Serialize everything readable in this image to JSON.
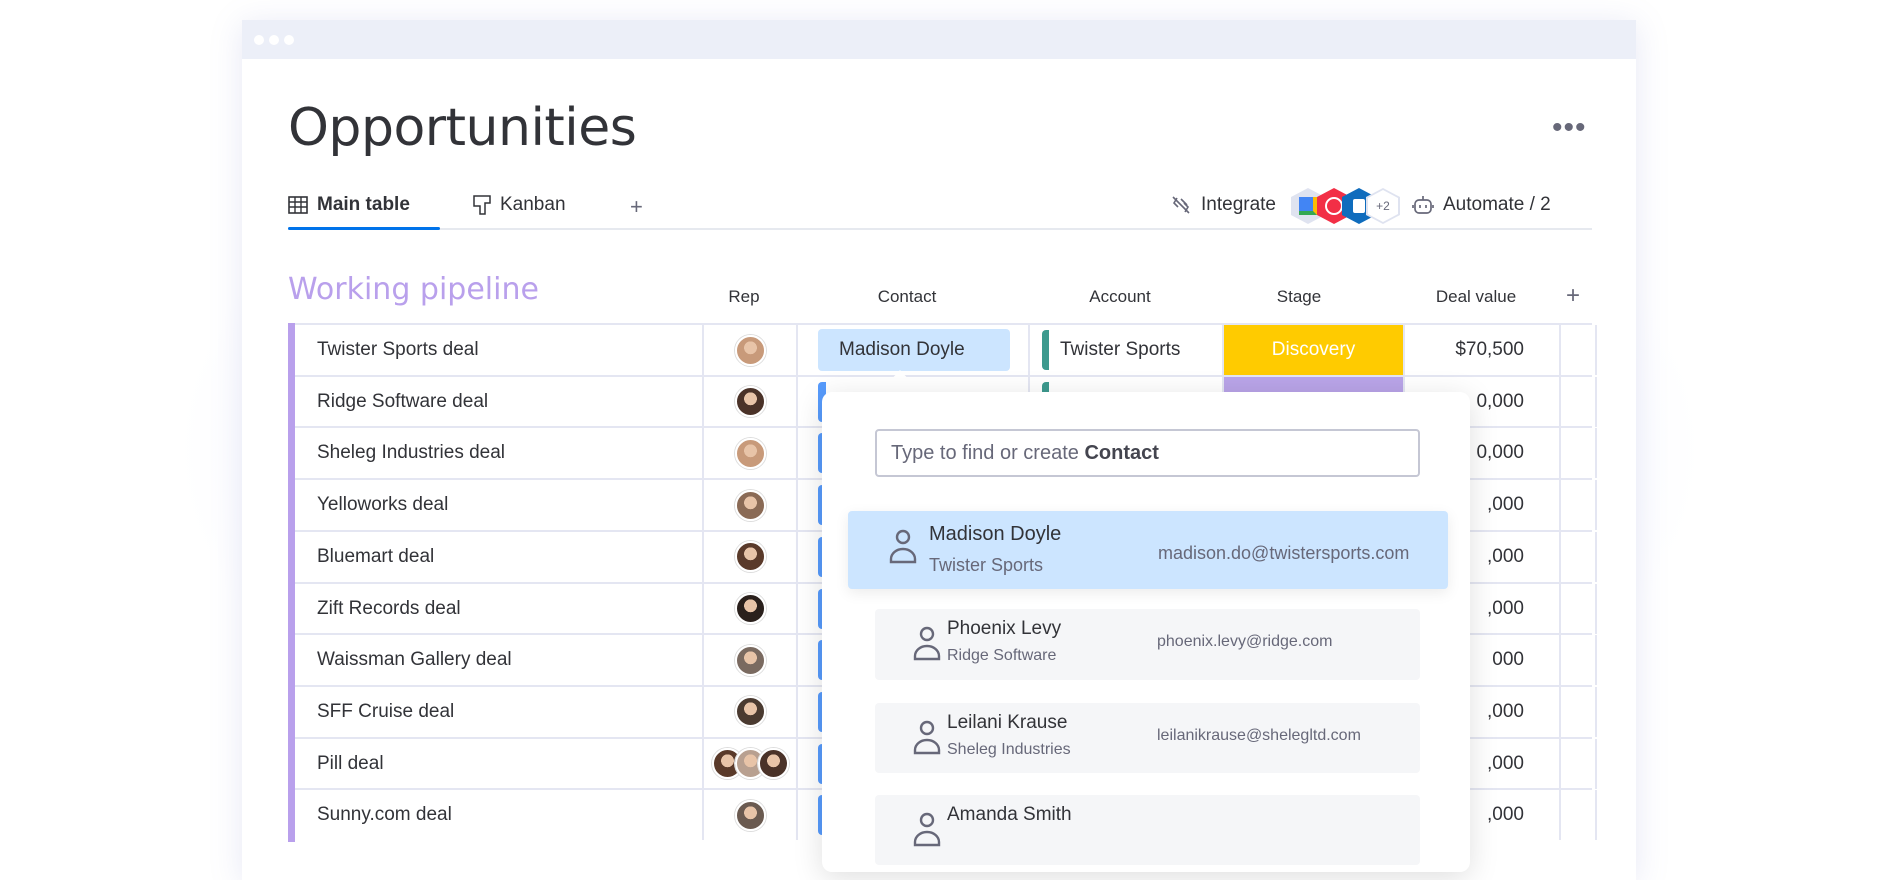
{
  "window": {
    "title": "Opportunities"
  },
  "tabs": [
    {
      "label": "Main table",
      "icon": "table-icon",
      "active": true
    },
    {
      "label": "Kanban",
      "icon": "kanban-icon",
      "active": false
    }
  ],
  "add_tab_label": "+",
  "toolbar": {
    "integrate_label": "Integrate",
    "integration_more": "+2",
    "integration_icons": [
      "google-calendar-icon",
      "twilio-icon",
      "outlook-icon"
    ],
    "automate_label": "Automate / 2"
  },
  "group": {
    "title": "Working pipeline",
    "color": "#b9a0ec",
    "columns": {
      "rep": "Rep",
      "contact": "Contact",
      "account": "Account",
      "stage": "Stage",
      "deal_value": "Deal value",
      "add": "+"
    }
  },
  "rows": [
    {
      "name": "Twister Sports deal",
      "reps": [
        "#c89a7a"
      ],
      "contact": "Madison Doyle",
      "account": "Twister Sports",
      "stage": "Discovery",
      "stage_color": "#ffcb00",
      "deal_value": "$70,500"
    },
    {
      "name": "Ridge Software deal",
      "reps": [
        "#4a3228"
      ],
      "contact": "",
      "account": "",
      "stage": "",
      "stage_color": "#b9a4e8",
      "deal_value": "0,000"
    },
    {
      "name": "Sheleg Industries deal",
      "reps": [
        "#c89a7a"
      ],
      "contact": "",
      "account": "",
      "stage": "",
      "stage_color": "",
      "deal_value": "0,000"
    },
    {
      "name": "Yelloworks deal",
      "reps": [
        "#8a6a55"
      ],
      "contact": "",
      "account": "",
      "stage": "",
      "stage_color": "",
      "deal_value": ",000"
    },
    {
      "name": "Bluemart deal",
      "reps": [
        "#5a3a2a"
      ],
      "contact": "",
      "account": "",
      "stage": "",
      "stage_color": "",
      "deal_value": ",000"
    },
    {
      "name": "Zift Records deal",
      "reps": [
        "#2a201c"
      ],
      "contact": "",
      "account": "",
      "stage": "",
      "stage_color": "",
      "deal_value": ",000"
    },
    {
      "name": "Waissman Gallery deal",
      "reps": [
        "#7a6a60"
      ],
      "contact": "",
      "account": "",
      "stage": "",
      "stage_color": "",
      "deal_value": "000"
    },
    {
      "name": "SFF Cruise deal",
      "reps": [
        "#4a3a30"
      ],
      "contact": "",
      "account": "",
      "stage": "",
      "stage_color": "",
      "deal_value": ",000"
    },
    {
      "name": "Pill deal",
      "reps": [
        "#5a3a2a",
        "#b8a090",
        "#4a3228"
      ],
      "contact": "",
      "account": "",
      "stage": "",
      "stage_color": "",
      "deal_value": ",000"
    },
    {
      "name": "Sunny.com deal",
      "reps": [
        "#6a5a50"
      ],
      "contact": "",
      "account": "",
      "stage": "",
      "stage_color": "",
      "deal_value": ",000"
    }
  ],
  "contact_picker": {
    "placeholder_prefix": "Type to find or create",
    "placeholder_entity": "Contact",
    "results": [
      {
        "name": "Madison Doyle",
        "company": "Twister Sports",
        "email": "madison.do@twistersports.com",
        "highlighted": true
      },
      {
        "name": "Phoenix Levy",
        "company": "Ridge Software",
        "email": "phoenix.levy@ridge.com",
        "highlighted": false
      },
      {
        "name": "Leilani Krause",
        "company": "Sheleg Industries",
        "email": "leilanikrause@shelegltd.com",
        "highlighted": false
      },
      {
        "name": "Amanda Smith",
        "company": "",
        "email": "",
        "highlighted": false
      }
    ]
  },
  "colors": {
    "accent": "#0073ea",
    "contact_chip": "#cce5ff",
    "contact_bar": "#579bfc",
    "account_bar": "#3d9a8e"
  }
}
